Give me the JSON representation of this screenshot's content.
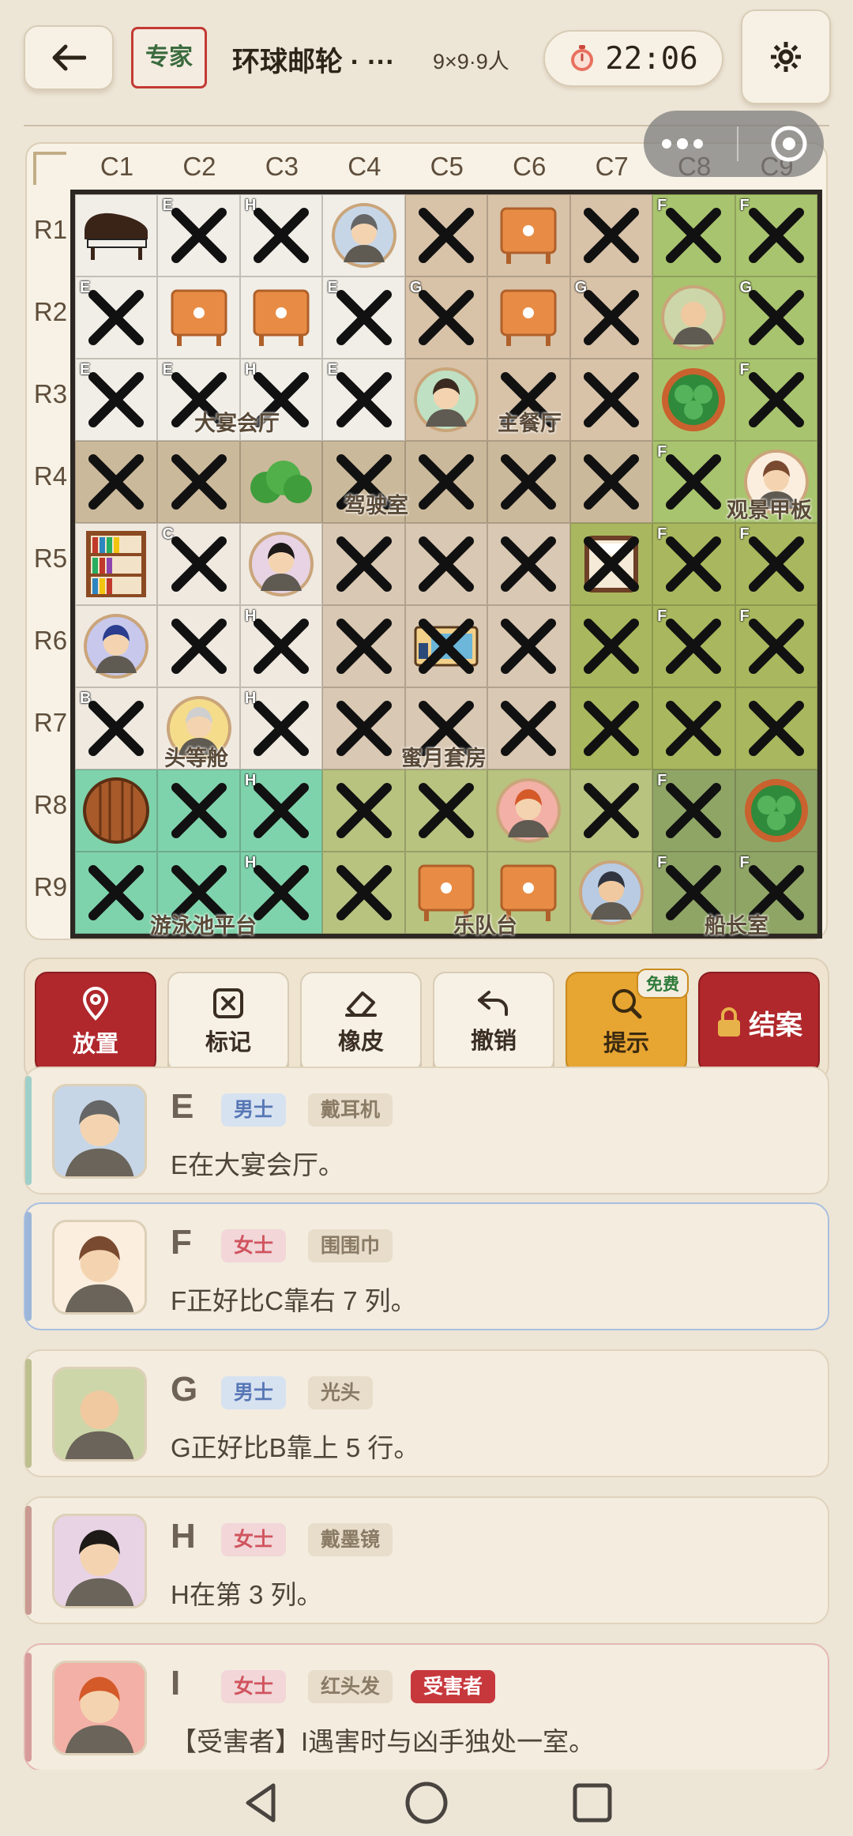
{
  "header": {
    "difficulty_badge": "专家",
    "title": "环球邮轮 · ···",
    "grid_size": "9×9·9人",
    "timer": "22:06"
  },
  "board": {
    "columns": [
      "C1",
      "C2",
      "C3",
      "C4",
      "C5",
      "C6",
      "C7",
      "C8",
      "C9"
    ],
    "rows": [
      "R1",
      "R2",
      "R3",
      "R4",
      "R5",
      "R6",
      "R7",
      "R8",
      "R9"
    ],
    "rooms": [
      "大宴会厅",
      "主餐厅",
      "驾驶室",
      "观景甲板",
      "蜜月套房",
      "头等舱",
      "游泳池平台",
      "乐队台",
      "船长室"
    ],
    "cell_tags": {
      "r1c2": "E",
      "r1c3": "H",
      "r1c8": "F",
      "r1c9": "F",
      "r2c1": "E",
      "r2c4": "E",
      "r2c5": "G",
      "r2c7": "G",
      "r2c9": "G",
      "r3c1": "E",
      "r3c2": "E",
      "r3c3": "H",
      "r3c4": "E",
      "r3c9": "F",
      "r4c8": "F",
      "r5c2": "C",
      "r5c8": "F",
      "r5c9": "F",
      "r6c3": "H",
      "r6c8": "F",
      "r6c9": "F",
      "r7c1": "B",
      "r7c3": "H",
      "r8c3": "H",
      "r8c8": "F",
      "r9c3": "H",
      "r9c8": "F",
      "r9c9": "F"
    }
  },
  "toolbar": {
    "place": "放置",
    "mark": "标记",
    "eraser": "橡皮",
    "undo": "撤销",
    "hint": "提示",
    "hint_badge": "免费",
    "close_case": "结案"
  },
  "clues": [
    {
      "letter": "E",
      "gender": "男士",
      "trait": "戴耳机",
      "text": "E在大宴会厅。"
    },
    {
      "letter": "F",
      "gender": "女士",
      "trait": "围围巾",
      "text": "F正好比C靠右 7 列。"
    },
    {
      "letter": "G",
      "gender": "男士",
      "trait": "光头",
      "text": "G正好比B靠上 5 行。"
    },
    {
      "letter": "H",
      "gender": "女士",
      "trait": "戴墨镜",
      "text": "H在第 3 列。"
    },
    {
      "letter": "I",
      "gender": "女士",
      "trait": "红头发",
      "victim": "受害者",
      "text": "【受害者】I遇害时与凶手独处一室。"
    }
  ],
  "colors": {
    "accent_red": "#b0282c",
    "hint_gold": "#e7a532",
    "background": "#ede5d6"
  }
}
